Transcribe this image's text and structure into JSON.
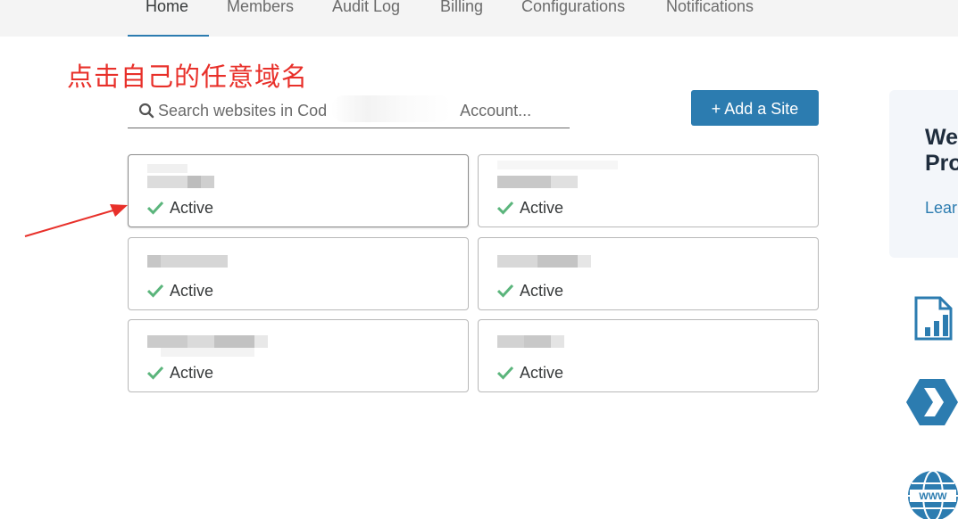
{
  "nav": {
    "tabs": [
      {
        "label": "Home",
        "active": true
      },
      {
        "label": "Members",
        "active": false
      },
      {
        "label": "Audit Log",
        "active": false
      },
      {
        "label": "Billing",
        "active": false
      },
      {
        "label": "Configurations",
        "active": false
      },
      {
        "label": "Notifications",
        "active": false
      }
    ]
  },
  "annotation": {
    "text": "点击自己的任意域名",
    "color": "#e8302a"
  },
  "search": {
    "placeholder": "Search websites in Cod                              Account...",
    "icon": "search-icon"
  },
  "add_site": {
    "label": "+ Add a Site"
  },
  "sites": [
    {
      "name_redacted": true,
      "status": "Active"
    },
    {
      "name_redacted": true,
      "status": "Active"
    },
    {
      "name_redacted": true,
      "status": "Active"
    },
    {
      "name_redacted": true,
      "status": "Active"
    },
    {
      "name_redacted": true,
      "status": "Active"
    },
    {
      "name_redacted": true,
      "status": "Active"
    }
  ],
  "promo": {
    "title": "We\nPro",
    "link": "Lear"
  },
  "side_icons": [
    "analytics-document-icon",
    "chevron-shield-icon",
    "www-globe-icon"
  ],
  "colors": {
    "accent": "#2c7cb0",
    "status_green": "#5bb57c",
    "annotation_red": "#e8302a"
  }
}
